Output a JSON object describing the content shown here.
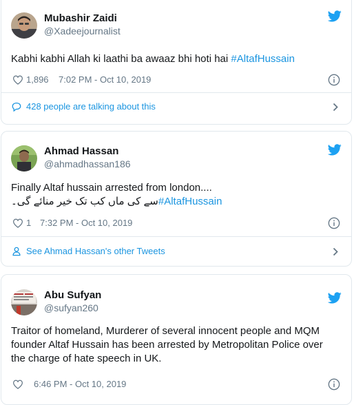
{
  "tweets": [
    {
      "name": "Mubashir Zaidi",
      "handle": "@Xadeejournalist",
      "text": "Kabhi kabhi Allah ki laathi ba awaaz bhi hoti hai ",
      "hashtag": "#AltafHussain",
      "likes": "1,896",
      "timestamp": "7:02 PM - Oct 10, 2019",
      "footer_link": "428 people are talking about this",
      "footer_icon": "speech-bubble-icon"
    },
    {
      "name": "Ahmad Hassan",
      "handle": "@ahmadhassan186",
      "text": "Finally Altaf hussain arrested from london....",
      "urdu_text": "سے کی ماں کب تک خیر منائے گی۔",
      "hashtag": "#AltafHussain",
      "likes": "1",
      "timestamp": "7:32 PM - Oct 10, 2019",
      "footer_link": "See Ahmad Hassan's other Tweets",
      "footer_icon": "person-icon"
    },
    {
      "name": "Abu Sufyan",
      "handle": "@sufyan260",
      "text": "Traitor of homeland, Murderer of several innocent people and MQM founder Altaf Hussain has been arrested by Metropolitan Police over the charge of hate speech in UK.",
      "likes": "",
      "timestamp": "6:46 PM - Oct 10, 2019"
    }
  ],
  "colors": {
    "link": "#1b95e0",
    "text": "#14171a",
    "secondary": "#657786",
    "border": "#e1e8ed",
    "twitter_bird": "#1da1f2"
  }
}
